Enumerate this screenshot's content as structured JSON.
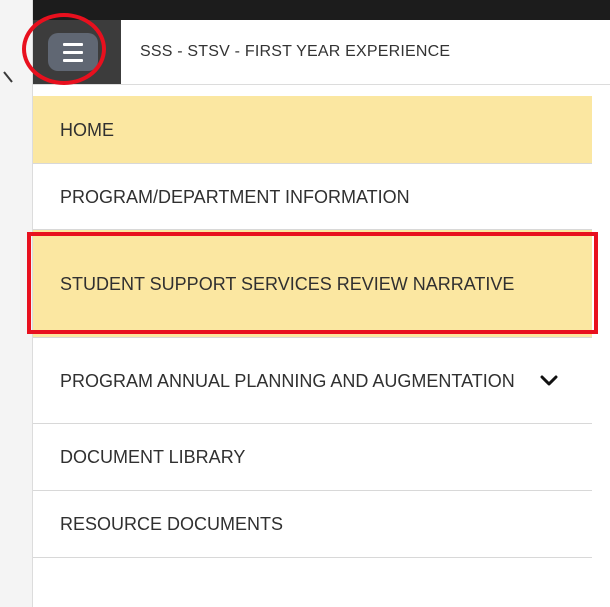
{
  "header": {
    "title": "SSS - STSV - FIRST YEAR EXPERIENCE"
  },
  "icons": {
    "menu": "hamburger-icon",
    "back": "back-arrow-icon",
    "expand": "chevron-down-icon"
  },
  "colors": {
    "active_item": "#fbe7a1",
    "highlight_annotation": "#e8101e",
    "menu_button": "#606773"
  },
  "menu": {
    "items": [
      {
        "label": "HOME",
        "active": true
      },
      {
        "label": "PROGRAM/DEPARTMENT INFORMATION",
        "active": false
      },
      {
        "label": "STUDENT SUPPORT SERVICES REVIEW NARRATIVE",
        "active": true
      },
      {
        "label": "PROGRAM ANNUAL PLANNING AND AUGMENTATION",
        "active": false,
        "expandable": true
      },
      {
        "label": "DOCUMENT LIBRARY",
        "active": false
      },
      {
        "label": "RESOURCE DOCUMENTS",
        "active": false
      }
    ]
  }
}
